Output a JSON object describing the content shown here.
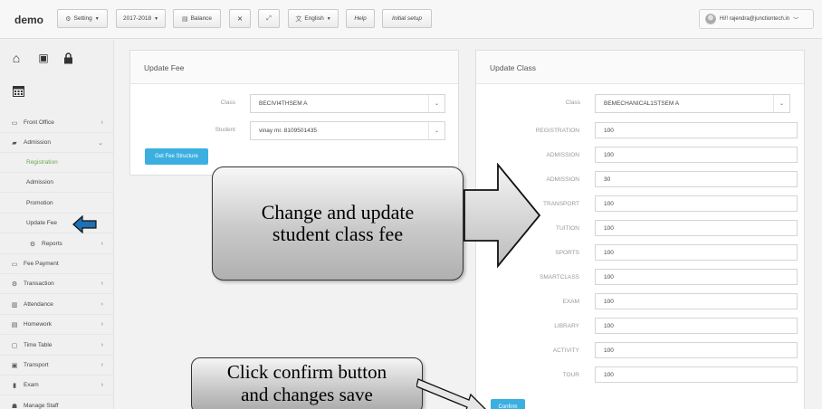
{
  "app": {
    "brand": "demo"
  },
  "toolbar": {
    "setting": "Setting",
    "session": "2017-2018",
    "balance": "Balance",
    "language": "English",
    "help": "Help",
    "initial_setup": "Initial setup",
    "user": "Hi!! rajendra@junctiontech.in"
  },
  "sidebar": {
    "items": [
      {
        "label": "Front Office",
        "icon": "monitor-icon"
      },
      {
        "label": "Admission",
        "icon": "graduation-cap-icon"
      },
      {
        "label": "Registration"
      },
      {
        "label": "Admission"
      },
      {
        "label": "Promotion"
      },
      {
        "label": "Update Fee"
      },
      {
        "label": "Reports",
        "icon": "gear-icon"
      },
      {
        "label": "Fee Payment",
        "icon": "money-icon"
      },
      {
        "label": "Transaction",
        "icon": "gear-icon"
      },
      {
        "label": "Attendance",
        "icon": "chart-icon"
      },
      {
        "label": "Homework",
        "icon": "document-icon"
      },
      {
        "label": "Time Table",
        "icon": "calendar-icon"
      },
      {
        "label": "Transport",
        "icon": "bus-icon"
      },
      {
        "label": "Exam",
        "icon": "book-icon"
      },
      {
        "label": "Manage Staff",
        "icon": "users-icon"
      }
    ]
  },
  "update_fee": {
    "title": "Update Fee",
    "class_label": "Class",
    "class_value": "BECIVI4THSEM A",
    "student_label": "Student",
    "student_value": "vinay mr. 8109501435",
    "button": "Get Fee Structure"
  },
  "update_class": {
    "title": "Update Class",
    "class_label": "Class",
    "class_value": "BEMECHANICAL1STSEM A",
    "fields": [
      {
        "label": "REGISTRATION",
        "value": "100"
      },
      {
        "label": "ADMISSION",
        "value": "100"
      },
      {
        "label": "ADMISSION",
        "value": "30"
      },
      {
        "label": "TRANSPORT",
        "value": "100"
      },
      {
        "label": "TUITION",
        "value": "100"
      },
      {
        "label": "SPORTS",
        "value": "100"
      },
      {
        "label": "SMARTCLASS",
        "value": "100"
      },
      {
        "label": "EXAM",
        "value": "100"
      },
      {
        "label": "LIBRARY",
        "value": "100"
      },
      {
        "label": "ACTIVITY",
        "value": "100"
      },
      {
        "label": "TOUR",
        "value": "100"
      }
    ],
    "confirm": "Confirm"
  },
  "annotations": {
    "callout1_line1": "Change  and update",
    "callout1_line2": "student class fee",
    "callout2_line1": "Click confirm button",
    "callout2_line2": "and changes save"
  },
  "colors": {
    "accent": "#3bb0e0",
    "active_sub": "#6aa84f",
    "arrow_blue": "#1f6fb2"
  }
}
